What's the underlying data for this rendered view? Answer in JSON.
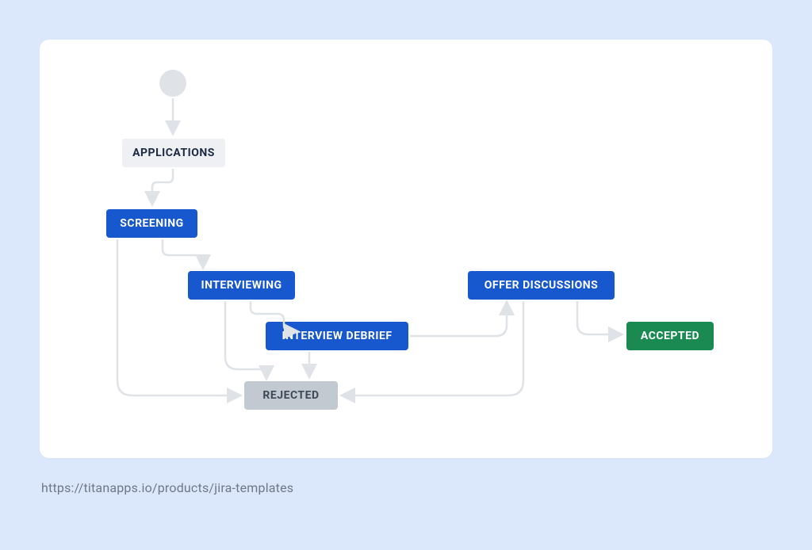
{
  "footer": {
    "url": "https://titanapps.io/products/jira-templates"
  },
  "nodes": {
    "applications": {
      "label": "APPLICATIONS"
    },
    "screening": {
      "label": "SCREENING"
    },
    "interviewing": {
      "label": "INTERVIEWING"
    },
    "debrief": {
      "label": "INTERVIEW DEBRIEF"
    },
    "offer": {
      "label": "OFFER DISCUSSIONS"
    },
    "accepted": {
      "label": "ACCEPTED"
    },
    "rejected": {
      "label": "REJECTED"
    }
  },
  "workflow": {
    "start": "applications",
    "edges": [
      [
        "applications",
        "screening"
      ],
      [
        "screening",
        "interviewing"
      ],
      [
        "screening",
        "rejected"
      ],
      [
        "interviewing",
        "debrief"
      ],
      [
        "interviewing",
        "rejected"
      ],
      [
        "debrief",
        "offer"
      ],
      [
        "debrief",
        "rejected"
      ],
      [
        "offer",
        "accepted"
      ],
      [
        "offer",
        "rejected"
      ]
    ],
    "terminal_accept": "accepted",
    "terminal_reject": "rejected"
  },
  "colors": {
    "edge": "#dfe2e6",
    "blue": "#1858ce",
    "green": "#1a8a52",
    "grey": "#c2c9d1",
    "light": "#eef0f3"
  }
}
